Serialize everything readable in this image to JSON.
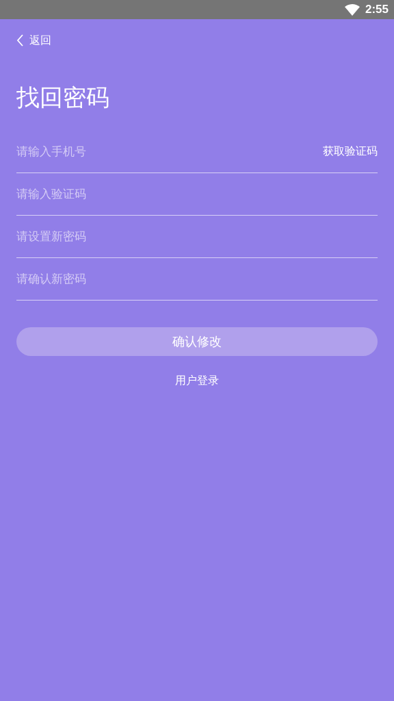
{
  "status_bar": {
    "time": "2:55"
  },
  "back": {
    "label": "返回"
  },
  "title": "找回密码",
  "fields": [
    {
      "placeholder": "请输入手机号",
      "action": "获取验证码"
    },
    {
      "placeholder": "请输入验证码"
    },
    {
      "placeholder": "请设置新密码"
    },
    {
      "placeholder": "请确认新密码"
    }
  ],
  "submit": {
    "label": "确认修改"
  },
  "login_link": "用户登录"
}
